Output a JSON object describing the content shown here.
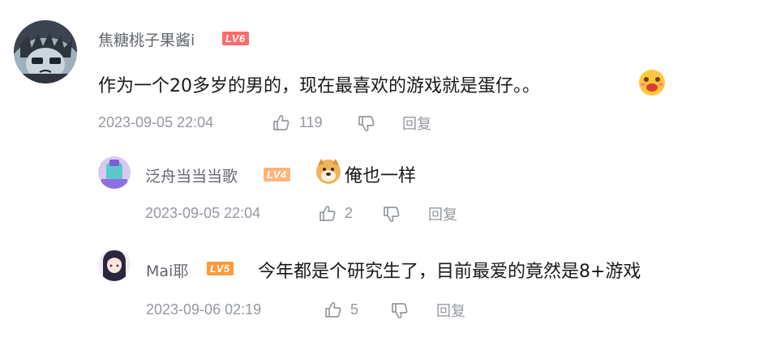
{
  "comments": [
    {
      "username": "焦糖桃子果酱i",
      "level": "LV6",
      "text": "作为一个20多岁的男的，现在最喜欢的游戏就是蛋仔。。",
      "time": "2023-09-05 22:04",
      "likes": "119",
      "reply_label": "回复"
    },
    {
      "username": "泛舟当当当歌",
      "level": "LV4",
      "text": "俺也一样",
      "time": "2023-09-05 22:04",
      "likes": "2",
      "reply_label": "回复"
    },
    {
      "username": "Mai耶",
      "level": "LV5",
      "text": "今年都是个研究生了，目前最爱的竟然是8+游戏",
      "time": "2023-09-06 02:19",
      "likes": "5",
      "reply_label": "回复"
    }
  ]
}
